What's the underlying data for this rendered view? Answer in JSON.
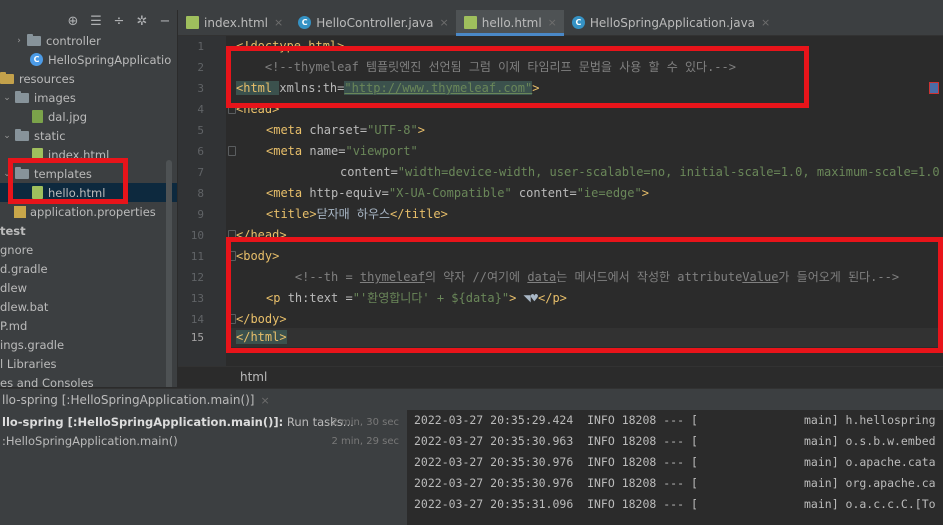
{
  "sidebar": {
    "toolbar": [
      {
        "icon": "crosshair-icon",
        "glyph": "⊕"
      },
      {
        "icon": "collapse-all-icon",
        "glyph": "☰"
      },
      {
        "icon": "expand-icon",
        "glyph": "÷"
      },
      {
        "icon": "gear-icon",
        "glyph": "✲"
      },
      {
        "icon": "minimize-icon",
        "glyph": "−"
      }
    ],
    "tree": [
      {
        "label": "controller",
        "kind": "folder",
        "chev": "›"
      },
      {
        "label": "HelloSpringApplicatio",
        "kind": "class"
      },
      {
        "label": "resources",
        "kind": "folder-res"
      },
      {
        "label": "images",
        "kind": "folder",
        "chev": "⌄"
      },
      {
        "label": "dal.jpg",
        "kind": "image"
      },
      {
        "label": "static",
        "kind": "folder",
        "chev": "⌄"
      },
      {
        "label": "index.html",
        "kind": "html"
      },
      {
        "label": "templates",
        "kind": "folder",
        "chev": "⌄"
      },
      {
        "label": "hello.html",
        "kind": "html",
        "selected": true
      },
      {
        "label": "application.properties",
        "kind": "props"
      },
      {
        "label": "test",
        "kind": "plain",
        "bold": true
      },
      {
        "label": "gnore",
        "kind": "plain"
      },
      {
        "label": "d.gradle",
        "kind": "plain"
      },
      {
        "label": "dlew",
        "kind": "plain"
      },
      {
        "label": "dlew.bat",
        "kind": "plain"
      },
      {
        "label": "P.md",
        "kind": "plain"
      },
      {
        "label": "ings.gradle",
        "kind": "plain"
      },
      {
        "label": "l Libraries",
        "kind": "plain"
      },
      {
        "label": "es and Consoles",
        "kind": "plain"
      }
    ]
  },
  "tabs": [
    {
      "label": "index.html",
      "kind": "html",
      "active": false
    },
    {
      "label": "HelloController.java",
      "kind": "java",
      "active": false
    },
    {
      "label": "hello.html",
      "kind": "html",
      "active": true
    },
    {
      "label": "HelloSpringApplication.java",
      "kind": "java",
      "active": false
    }
  ],
  "tab_close_glyph": "×",
  "editor": {
    "line_numbers": [
      "1",
      "2",
      "3",
      "4",
      "5",
      "6",
      "7",
      "8",
      "9",
      "10",
      "11",
      "12",
      "13",
      "14",
      "15"
    ],
    "current_line": "15",
    "breadcrumb": "html",
    "code": {
      "l1": "<!doctype html>",
      "l2": "    <!--thymeleaf 템플릿엔진 선언됨 그럼 이제 타임리프 문법을 사용 할 수 있다.-->",
      "l3_tag": "<html ",
      "l3_attr": "xmlns:th=",
      "l3_val": "\"http://www.thymeleaf.com\"",
      "l3_end": ">",
      "l4": "<head>",
      "l5_tag": "<meta ",
      "l5_attr": "charset=",
      "l5_val": "\"UTF-8\"",
      "l5_end": ">",
      "l6_tag": "<meta ",
      "l6_attr": "name=",
      "l6_val": "\"viewport\"",
      "l7_attr": "content=",
      "l7_val": "\"width=device-width, user-scalable=no, initial-scale=1.0, maximum-scale=1.0",
      "l8_tag": "<meta ",
      "l8_attr1": "http-equiv=",
      "l8_val1": "\"X-UA-Compatible\"",
      "l8_attr2": " content=",
      "l8_val2": "\"ie=edge\"",
      "l8_end": ">",
      "l9_open": "<title>",
      "l9_text": "닫자매 하우스",
      "l9_close": "</title>",
      "l10": "</head>",
      "l11": "<body>",
      "l12_a": "    <!--th = ",
      "l12_b": "thymeleaf",
      "l12_c": "의 약자 //여기에 ",
      "l12_d": "data",
      "l12_e": "는 메서드에서 작성한 attribute",
      "l12_f": "Value",
      "l12_g": "가 들어오게 된다.-->",
      "l13_tag": "<p ",
      "l13_attr": "th:text =",
      "l13_val": "\"'환영합니다' + ${data}\"",
      "l13_end": ">",
      "l13_text": " ◥♥",
      "l13_close": "</p>",
      "l14": "</body>",
      "l15": "</html>"
    }
  },
  "run": {
    "title": "llo-spring [:HelloSpringApplication.main()]",
    "rows": [
      {
        "name_bold": "llo-spring [:HelloSpringApplication.main()]:",
        "name_rest": " Run tasks...",
        "time": "2 min, 30 sec"
      },
      {
        "name_bold": "",
        "name_rest": ":HelloSpringApplication.main()",
        "time": "2 min, 29 sec"
      }
    ]
  },
  "console": {
    "lines": [
      {
        "text": "2022-03-27 20:35:29.424  INFO 18208 --- [",
        "main": "main] h.hellospring"
      },
      {
        "text": "2022-03-27 20:35:30.963  INFO 18208 --- [",
        "main": "main] o.s.b.w.embed"
      },
      {
        "text": "2022-03-27 20:35:30.976  INFO 18208 --- [",
        "main": "main] o.apache.cata"
      },
      {
        "text": "2022-03-27 20:35:30.976  INFO 18208 --- [",
        "main": "main] org.apache.ca"
      },
      {
        "text": "2022-03-27 20:35:31.096  INFO 18208 --- [",
        "main": "main] o.a.c.c.C.[To"
      }
    ]
  },
  "colors": {
    "highlight_box": "#e8141a",
    "tag": "#e8bf6a",
    "string": "#6a8759",
    "comment": "#808080",
    "active_tab_underline": "#4a88c7"
  }
}
